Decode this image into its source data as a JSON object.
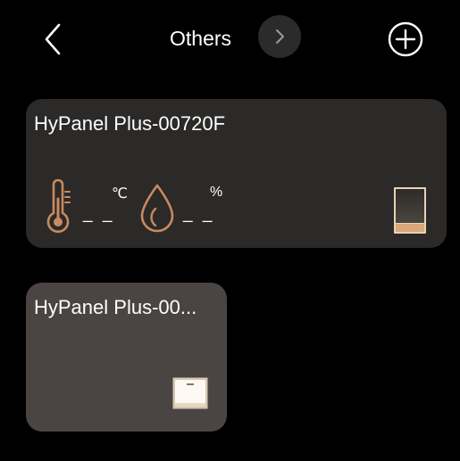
{
  "header": {
    "title": "Others"
  },
  "devices": [
    {
      "name": "HyPanel Plus-00720F",
      "temperature_value": "_ _",
      "temperature_unit": "℃",
      "humidity_value": "_ _",
      "humidity_unit": "%"
    },
    {
      "name": "HyPanel Plus-00..."
    }
  ],
  "colors": {
    "background": "#000000",
    "card_dark": "#2b2a29",
    "card_selected": "#4a4542",
    "accent_copper": "#c88a5e",
    "next_button_bg": "#2b2b2b"
  },
  "icons": {
    "back": "chevron-left-icon",
    "next": "chevron-right-icon",
    "add": "plus-circle-icon",
    "temperature": "thermometer-icon",
    "humidity": "water-drop-icon",
    "panel": "panel-device-icon",
    "switch": "wall-switch-icon"
  }
}
